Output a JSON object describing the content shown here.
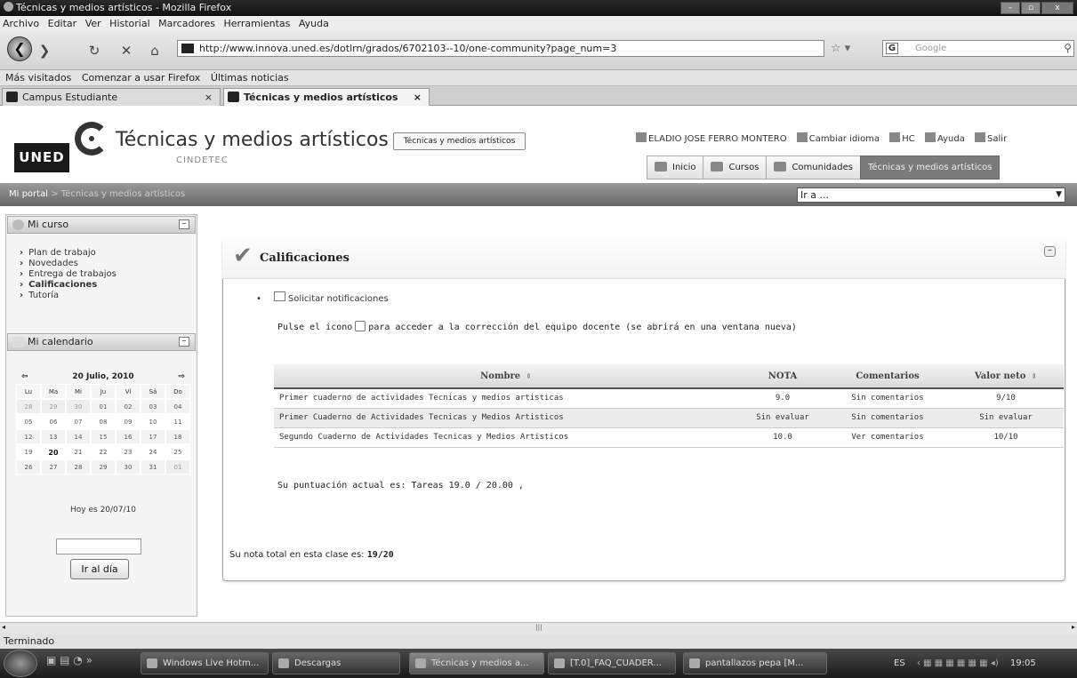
{
  "window": {
    "title": "Técnicas y medios artísticos - Mozilla Firefox",
    "controls": [
      "–",
      "▫",
      "x"
    ]
  },
  "menubar": [
    "Archivo",
    "Editar",
    "Ver",
    "Historial",
    "Marcadores",
    "Herramientas",
    "Ayuda"
  ],
  "navbar": {
    "url": "http://www.innova.uned.es/dotlrn/grados/6702103--10/one-community?page_num=3",
    "search_placeholder": "Google"
  },
  "bookmarks": [
    "Más visitados",
    "Comenzar a usar Firefox",
    "Últimas noticias"
  ],
  "tabs": [
    {
      "label": "Campus Estudiante"
    },
    {
      "label": "Técnicas y medios artísticos"
    }
  ],
  "site": {
    "logo_text": "UNED",
    "title": "Técnicas y medios artísticos",
    "subtitle": "CINDETEC",
    "title_box": "Técnicas y medios artísticos",
    "user": "ELADIO JOSE FERRO MONTERO",
    "user_links": [
      "Cambiar idioma",
      "HC",
      "Ayuda",
      "Salir"
    ],
    "nav": [
      "Inicio",
      "Cursos",
      "Comunidades",
      "Técnicas y medios artísticos"
    ],
    "breadcrumb_root": "Mi portal",
    "breadcrumb_sep": ">",
    "breadcrumb_current": "Técnicas y medios artísticos",
    "goto_label": "Ir a ..."
  },
  "sidebar": {
    "curso_title": "Mi curso",
    "curso_items": [
      "Plan de trabajo",
      "Novedades",
      "Entrega de trabajos",
      "Calificaciones",
      "Tutoría"
    ],
    "calendar_title": "Mi calendario",
    "calendar_month": "20 Julio, 2010",
    "calendar_prev": "⇦",
    "calendar_next": "⇨",
    "weekdays": [
      "Lu",
      "Ma",
      "Mi",
      "Ju",
      "Vi",
      "Sá",
      "Do"
    ],
    "weeks": [
      [
        "28",
        "29",
        "30",
        "01",
        "02",
        "03",
        "04"
      ],
      [
        "05",
        "06",
        "07",
        "08",
        "09",
        "10",
        "11"
      ],
      [
        "12",
        "13",
        "14",
        "15",
        "16",
        "17",
        "18"
      ],
      [
        "19",
        "20",
        "21",
        "22",
        "23",
        "24",
        "25"
      ],
      [
        "26",
        "27",
        "28",
        "29",
        "30",
        "31",
        "01"
      ]
    ],
    "today_text": "Hoy es 20/07/10",
    "goto_day_button": "Ir al día"
  },
  "main": {
    "section_title": "Calificaciones",
    "notify_link": "Solicitar notificaciones",
    "instructions_before": "Pulse el icono",
    "instructions_after": "para acceder a la corrección del equipo docente (se abrirá en una ventana nueva)",
    "table": {
      "columns": [
        "Nombre",
        "NOTA",
        "Comentarios",
        "Valor neto"
      ],
      "sort_glyph": "⇕",
      "rows": [
        [
          "Primer cuaderno de actividades Tecnicas y medios artisticas",
          "9.0",
          "Sin comentarios",
          "9/10"
        ],
        [
          "Primer Cuaderno de Actividades Tecnicas y Medios Artisticos",
          "Sin evaluar",
          "Sin comentarios",
          "Sin evaluar"
        ],
        [
          "Segundo Cuaderno de Actividades Tecnicas y Medios Artisticos",
          "10.0",
          "Ver comentarios",
          "10/10"
        ]
      ]
    },
    "current_score": "Su puntuación actual es: Tareas 19.0 / 20.00 ,",
    "total_label": "Su nota total en esta clase es:",
    "total_value": "19/20"
  },
  "statusbar": {
    "text": "Terminado"
  },
  "taskbar": {
    "items": [
      "Windows Live Hotm...",
      "Descargas",
      "Técnicas y medios a...",
      "[T.0]_FAQ_CUADER...",
      "pantallazos pepa [M..."
    ],
    "lang": "ES",
    "clock": "19:05"
  }
}
